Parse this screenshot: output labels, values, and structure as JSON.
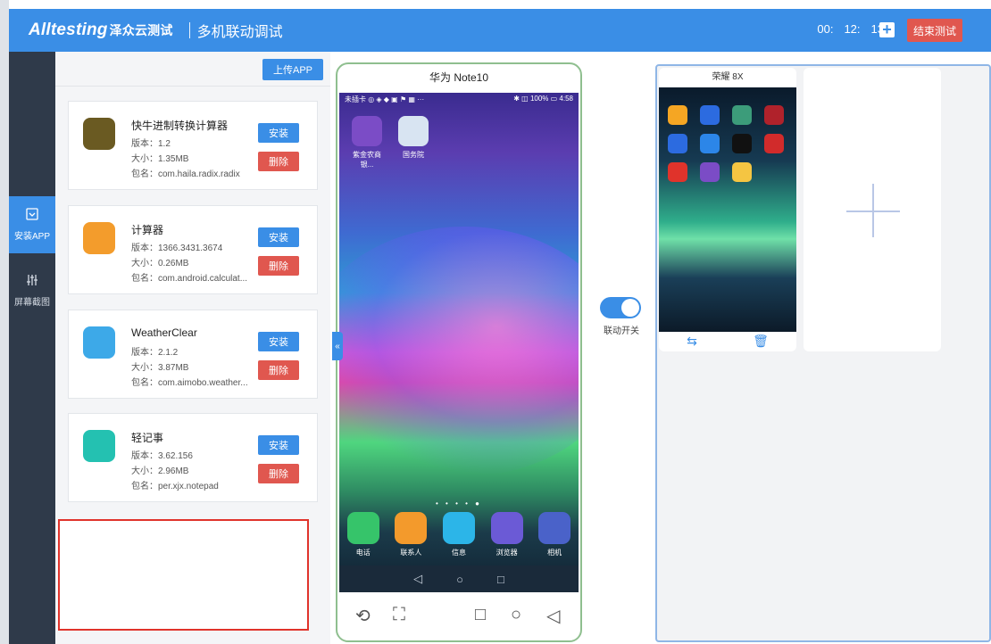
{
  "header": {
    "logo": "Alltesting",
    "logo_sub": "泽众云测试",
    "title": "多机联动调试",
    "timer": [
      "00:",
      "12:",
      "13"
    ],
    "add_label": "+",
    "end_label": "结束测试"
  },
  "sidenav": {
    "items": [
      {
        "label": "安装APP",
        "icon": "inbox-icon",
        "active": true
      },
      {
        "label": "屏幕截图",
        "icon": "sliders-icon",
        "active": false
      }
    ]
  },
  "panel": {
    "upload_label": "上传APP",
    "apps": [
      {
        "name": "快牛进制转换计算器",
        "version": "版本：1.2",
        "size": "大小：1.35MB",
        "package": "包名：com.haila.radix.radix",
        "install": "安装",
        "delete": "删除",
        "icon_color": "#6a5a22"
      },
      {
        "name": "计算器",
        "version": "版本：1366.3431.3674",
        "size": "大小：0.26MB",
        "package": "包名：com.android.calculat...",
        "install": "安装",
        "delete": "删除",
        "icon_color": "#f39c2c"
      },
      {
        "name": "WeatherClear",
        "version": "版本：2.1.2",
        "size": "大小：3.87MB",
        "package": "包名：com.aimobo.weather...",
        "install": "安装",
        "delete": "删除",
        "icon_color": "#3da9e8"
      },
      {
        "name": "轻记事",
        "version": "版本：3.62.156",
        "size": "大小：2.96MB",
        "package": "包名：per.xjx.notepad",
        "install": "安装",
        "delete": "删除",
        "icon_color": "#24c1b1"
      }
    ]
  },
  "main_phone": {
    "title": "华为 Note10",
    "status_left": "未插卡 ◎ ◈ ◆ ▣ ⚑ ▦ ···",
    "status_right": "✱ ◫ 100% ▭ 4:58",
    "home_apps": [
      {
        "label": "紫金农商银...",
        "color": "#7b4cc6"
      },
      {
        "label": "国务院",
        "color": "#d8e4f2"
      }
    ],
    "page_dots": "• • • • ●",
    "dock": [
      {
        "label": "电话",
        "color": "#36c46a"
      },
      {
        "label": "联系人",
        "color": "#f39a2c"
      },
      {
        "label": "信息",
        "color": "#2cb5e8"
      },
      {
        "label": "浏览器",
        "color": "#6b5ad6"
      },
      {
        "label": "相机",
        "color": "#4a62c9"
      }
    ],
    "sys_nav": [
      "◁",
      "○",
      "□"
    ],
    "toolbar": [
      "⟲",
      "⛶",
      "□",
      "○",
      "◁"
    ]
  },
  "toggle": {
    "label": "联动开关",
    "on": true
  },
  "right_panel": {
    "device_title": "荣耀 8X",
    "mini_icons": [
      "#f5a623",
      "#2c6be0",
      "#3c9c7a",
      "#b0222b",
      "#2c6be0",
      "#2c86e8",
      "#111111",
      "#d12b2b",
      "#e0332b",
      "#7b4cc6",
      "#f5c542"
    ],
    "actions": [
      "⇆",
      "🗑"
    ]
  }
}
